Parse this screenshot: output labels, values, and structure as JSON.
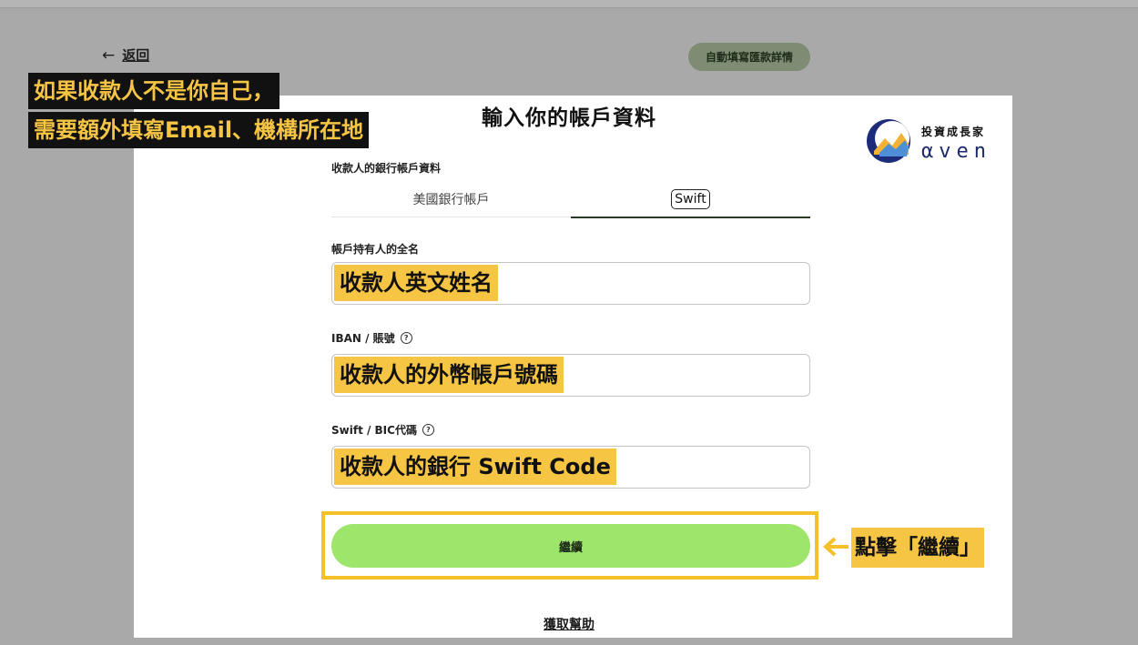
{
  "nav": {
    "back_arrow": "←",
    "back_label": "返回",
    "autofill_button": "自動填寫匯款詳情"
  },
  "page": {
    "title": "輸入你的帳戶資料"
  },
  "overlay": {
    "note_line1": "如果收款人不是你自己，",
    "note_line2": "需要額外填寫Email、機構所在地"
  },
  "logo": {
    "brand_zh": "投資成長家",
    "brand_en": "αven"
  },
  "bank_section": {
    "label": "收款人的銀行帳戶資料",
    "tabs": [
      {
        "label": "美國銀行帳戶"
      },
      {
        "label": "Swift",
        "active": true
      }
    ]
  },
  "fields": {
    "holder_name": {
      "label": "帳戶持有人的全名",
      "value": "收款人英文姓名"
    },
    "iban": {
      "label": "IBAN / 賬號",
      "help_icon": "?",
      "value": "收款人的外幣帳戶號碼"
    },
    "swift": {
      "label": "Swift / BIC代碼",
      "help_icon": "?",
      "value": "收款人的銀行  Swift Code"
    }
  },
  "actions": {
    "continue_label": "繼續",
    "help_link": "獲取幫助"
  },
  "annotation": {
    "click_note": "點擊「繼續」"
  },
  "colors": {
    "highlight": "#f6c544",
    "continue_green": "#9ee56c",
    "annotation_frame": "#f5c02c"
  }
}
